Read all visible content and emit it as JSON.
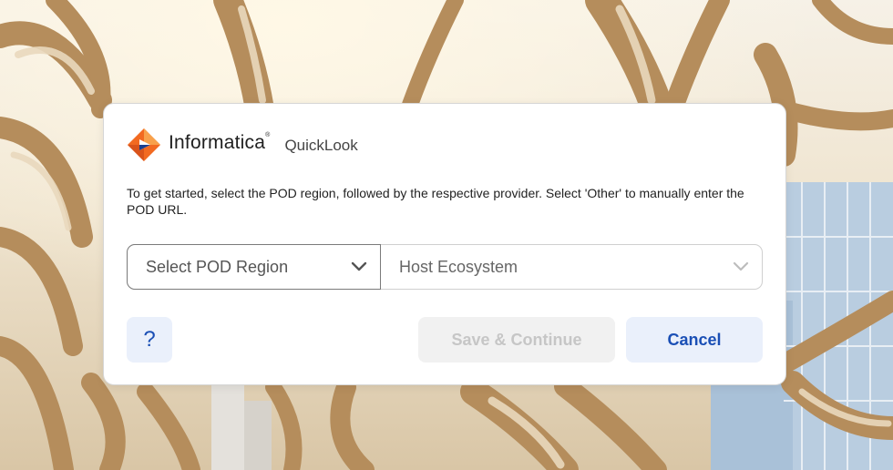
{
  "brand": {
    "logo_text": "Informatica",
    "trademark": "®",
    "product": "QuickLook"
  },
  "intro_text": "To get started, select the POD region, followed by the respective provider. Select 'Other' to manually enter the POD URL.",
  "pod_region": {
    "placeholder": "Select POD Region"
  },
  "host_ecosystem": {
    "placeholder": "Host Ecosystem"
  },
  "buttons": {
    "help": "?",
    "save": "Save & Continue",
    "cancel": "Cancel"
  },
  "icons": {
    "logo": "informatica-logo-icon",
    "chevron": "chevron-down-icon"
  },
  "colors": {
    "accent": "#1a4fb5",
    "accent_bg": "#eaf0fb",
    "disabled_bg": "#f1f1f1",
    "disabled_text": "#c6c6c6",
    "logo_orange": "#f26a21"
  }
}
